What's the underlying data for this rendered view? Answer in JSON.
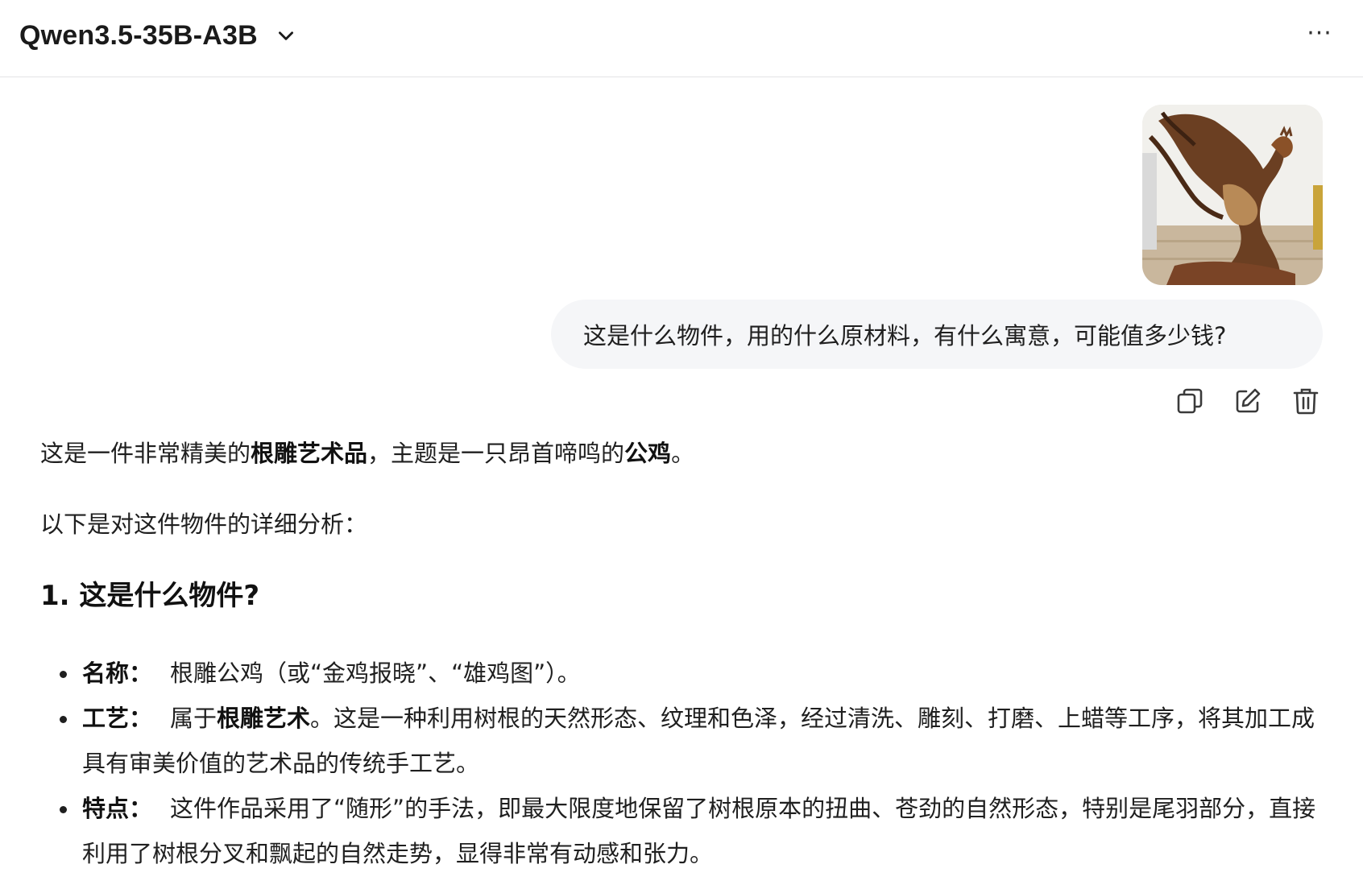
{
  "header": {
    "model_name": "Qwen3.5-35B-A3B",
    "more_label": "···"
  },
  "user_message": {
    "text": "这是什么物件，用的什么原材料，有什么寓意，可能值多少钱?",
    "image_icon": "rooster-root-carving-photo"
  },
  "actions": {
    "copy_icon": "copy-icon",
    "edit_icon": "edit-icon",
    "delete_icon": "trash-icon"
  },
  "answer": {
    "intro": {
      "t1": "这是一件非常精美的",
      "b1": "根雕艺术品",
      "t2": "，主题是一只昂首啼鸣的",
      "b2": "公鸡",
      "t3": "。"
    },
    "intro2": "以下是对这件物件的详细分析：",
    "section1_title": "1. 这是什么物件?",
    "bullets": [
      {
        "label": "名称：",
        "t1": "根雕公鸡（或“金鸡报晓”、“雄鸡图”）。"
      },
      {
        "label": "工艺：",
        "t1": "属于",
        "b1": "根雕艺术",
        "t2": "。这是一种利用树根的天然形态、纹理和色泽，经过清洗、雕刻、打磨、上蜡等工序，将其加工成具有审美价值的艺术品的传统手工艺。"
      },
      {
        "label": "特点：",
        "t1": "这件作品采用了“随形”的手法，即最大限度地保留了树根原本的扭曲、苍劲的自然形态，特别是尾羽部分，直接利用了树根分叉和飘起的自然走势，显得非常有动感和张力。"
      }
    ]
  }
}
